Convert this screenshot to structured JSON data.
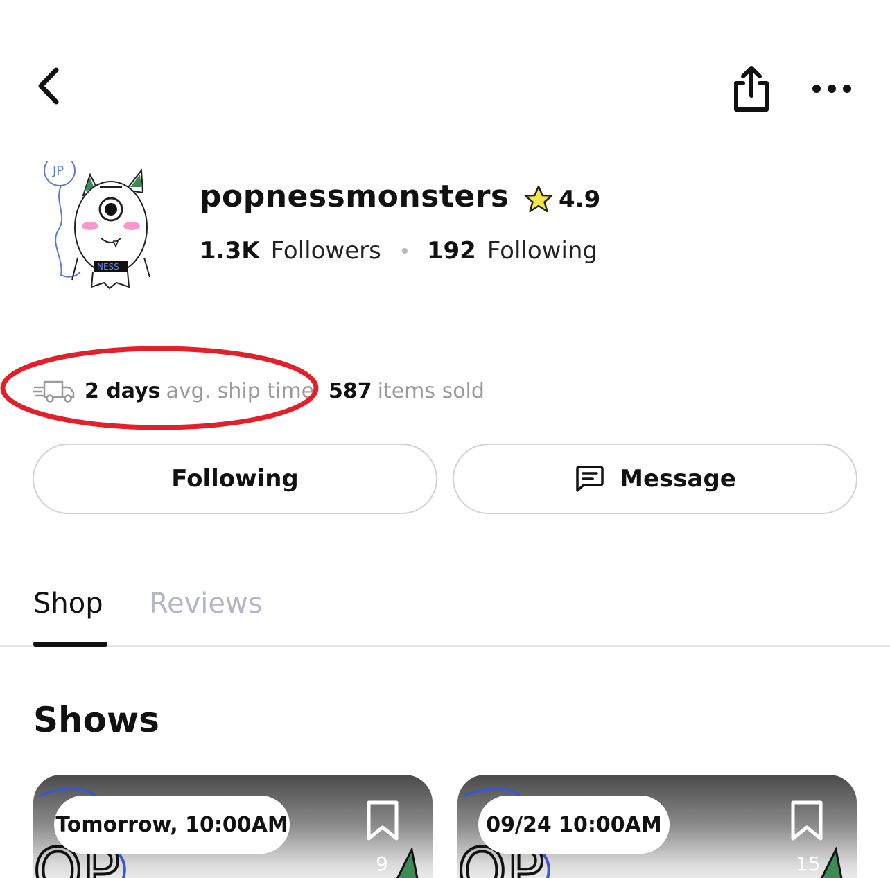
{
  "profile": {
    "username": "popnessmonsters",
    "rating": "4.9",
    "followers_count": "1.3K",
    "followers_label": "Followers",
    "following_count": "192",
    "following_label": "Following",
    "avatar_badge_text": "NESS"
  },
  "shop_stats": {
    "ship_value": "2 days",
    "ship_label": "avg. ship time",
    "sold_value": "587",
    "sold_label": "items sold"
  },
  "actions": {
    "following_label": "Following",
    "message_label": "Message"
  },
  "tabs": [
    {
      "label": "Shop",
      "active": true
    },
    {
      "label": "Reviews",
      "active": false
    }
  ],
  "shows": {
    "title": "Shows",
    "cards": [
      {
        "time": "Tomorrow, 10:00AM",
        "bookmark_count": "9"
      },
      {
        "time": "09/24 10:00AM",
        "bookmark_count": "15"
      }
    ]
  },
  "colors": {
    "annotation": "#e3202a",
    "star": "#f7e64a",
    "muted_text": "#9a9a9a",
    "inactive_tab": "#b3b7c3"
  },
  "icons": [
    "back-chevron-icon",
    "share-icon",
    "more-icon",
    "star-icon",
    "truck-icon",
    "message-icon",
    "bookmark-icon"
  ]
}
